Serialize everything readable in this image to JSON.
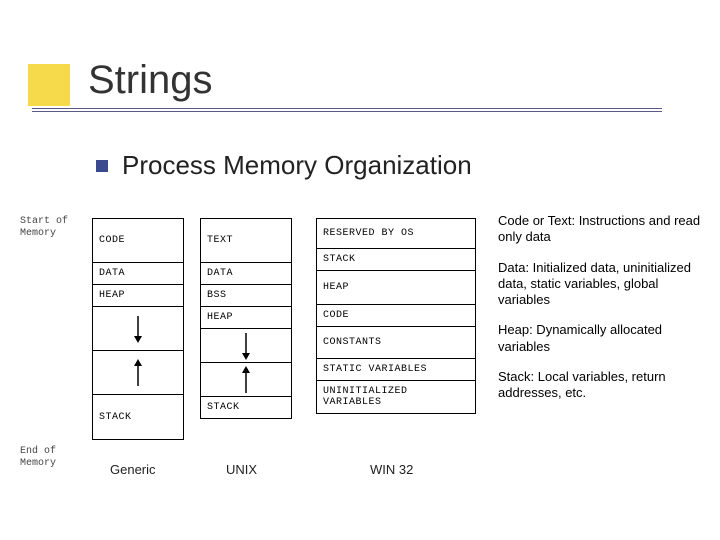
{
  "title": "Strings",
  "subtitle": "Process Memory Organization",
  "memoryLabels": {
    "start": "Start of\nMemory",
    "end": "End of\nMemory"
  },
  "columns": {
    "generic": {
      "label": "Generic",
      "segments": [
        "CODE",
        "DATA",
        "HEAP",
        "↓",
        "↑",
        "STACK"
      ]
    },
    "unix": {
      "label": "UNIX",
      "segments": [
        "TEXT",
        "DATA",
        "BSS",
        "HEAP",
        "↓",
        "↑",
        "STACK"
      ]
    },
    "win32": {
      "label": "WIN 32",
      "segments": [
        "RESERVED BY OS",
        "STACK",
        "HEAP",
        "CODE",
        "CONSTANTS",
        "STATIC VARIABLES",
        "UNINITIALIZED VARIABLES"
      ]
    }
  },
  "descriptions": {
    "code": "Code or Text: Instructions and read only data",
    "data": "Data: Initialized data, uninitialized data, static variables, global variables",
    "heap": "Heap: Dynamically allocated variables",
    "stack": "Stack:  Local variables, return addresses, etc."
  }
}
